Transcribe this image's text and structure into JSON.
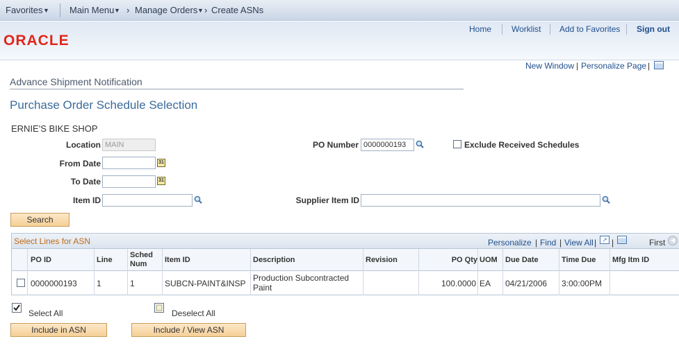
{
  "topbar": {
    "favorites": "Favorites",
    "main_menu": "Main Menu",
    "breadcrumb_1": "Manage Orders",
    "breadcrumb_2": "Create ASNs"
  },
  "header": {
    "logo": "ORACLE",
    "home": "Home",
    "worklist": "Worklist",
    "add_to_favorites": "Add to Favorites",
    "sign_out": "Sign out"
  },
  "page_links": {
    "new_window": "New Window",
    "personalize_page": "Personalize Page"
  },
  "page": {
    "component_title": "Advance Shipment Notification",
    "title": "Purchase Order Schedule Selection",
    "business_unit": "ERNIE'S BIKE SHOP"
  },
  "form": {
    "location_label": "Location",
    "location_value": "MAIN",
    "po_number_label": "PO Number",
    "po_number_value": "0000000193",
    "exclude_label": "Exclude Received Schedules",
    "from_date_label": "From Date",
    "to_date_label": "To Date",
    "item_id_label": "Item ID",
    "supplier_item_id_label": "Supplier Item ID",
    "search_button": "Search",
    "cal_glyph": "31"
  },
  "grid": {
    "title": "Select Lines for ASN",
    "nav_personalize": "Personalize",
    "nav_find": "Find",
    "nav_view_all": "View All",
    "nav_first": "First",
    "columns": {
      "po_id": "PO ID",
      "line": "Line",
      "sched_1": "Sched",
      "sched_2": "Num",
      "item_id": "Item ID",
      "description": "Description",
      "revision": "Revision",
      "po_qty": "PO Qty",
      "uom": "UOM",
      "due_date": "Due Date",
      "time_due": "Time Due",
      "mfg_itm_id": "Mfg Itm ID"
    },
    "rows": [
      {
        "po_id": "0000000193",
        "line": "1",
        "sched": "1",
        "item_id": "SUBCN-PAINT&INSP",
        "desc_1": "Production Subcontracted",
        "desc_2": "Paint",
        "revision": "",
        "po_qty": "100.0000",
        "uom": "EA",
        "due_date": "04/21/2006",
        "time_due": "3:00:00PM",
        "mfg_itm_id": ""
      }
    ]
  },
  "actions": {
    "select_all": "Select All",
    "deselect_all": "Deselect All",
    "include_in_asn": "Include in ASN",
    "include_view_asn": "Include / View ASN"
  },
  "colors": {
    "accent": "#3a6b9b",
    "grid_title": "#c06a16",
    "oracle_red": "#e0261b"
  }
}
